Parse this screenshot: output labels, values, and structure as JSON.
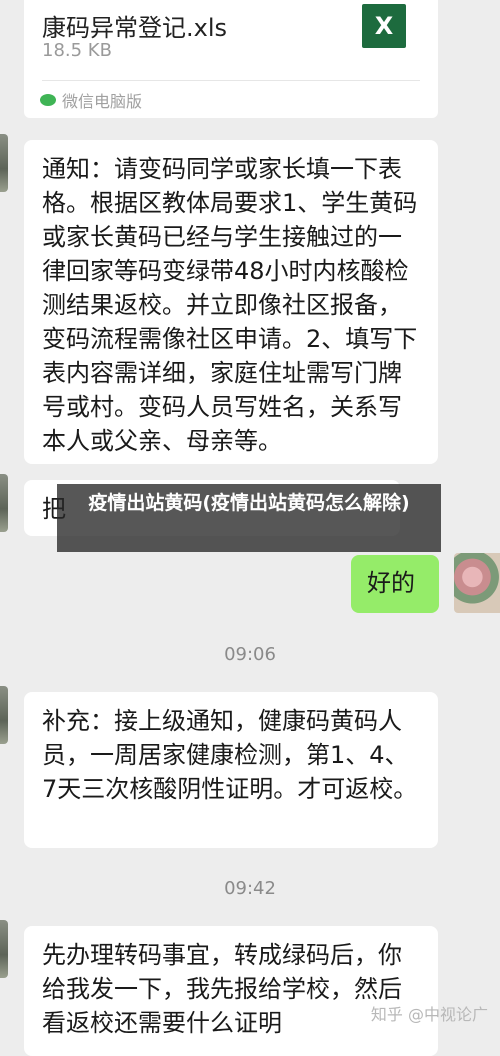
{
  "file_message": {
    "name": "康码异常登记.xls",
    "size": "18.5 KB",
    "icon_letter": "X",
    "source": "微信电脑版"
  },
  "messages": {
    "notice": "通知：请变码同学或家长填一下表格。根据区教体局要求1、学生黄码或家长黄码已经与学生接触过的一律回家等码变绿带48小时内核酸检测结果返校。并立即像社区报备，变码流程需像社区申请。2、填写下表内容需详细，家庭住址需写门牌号或村。变码人员写姓名，关系写本人或父亲、母亲等。",
    "partial": "把",
    "reply_ok": "好的",
    "supplement": "补充：接上级通知，健康码黄码人员，一周居家健康检测，第1、4、7天三次核酸阴性证明。才可返校。",
    "question": "先办理转码事宜，转成绿码后，你给我发一下，我先报给学校，然后看返校还需要什么证明"
  },
  "timestamps": [
    "09:06",
    "09:42"
  ],
  "overlay_title": "疫情出站黄码(疫情出站黄码怎么解除)",
  "watermark": "知乎 @中视论广"
}
